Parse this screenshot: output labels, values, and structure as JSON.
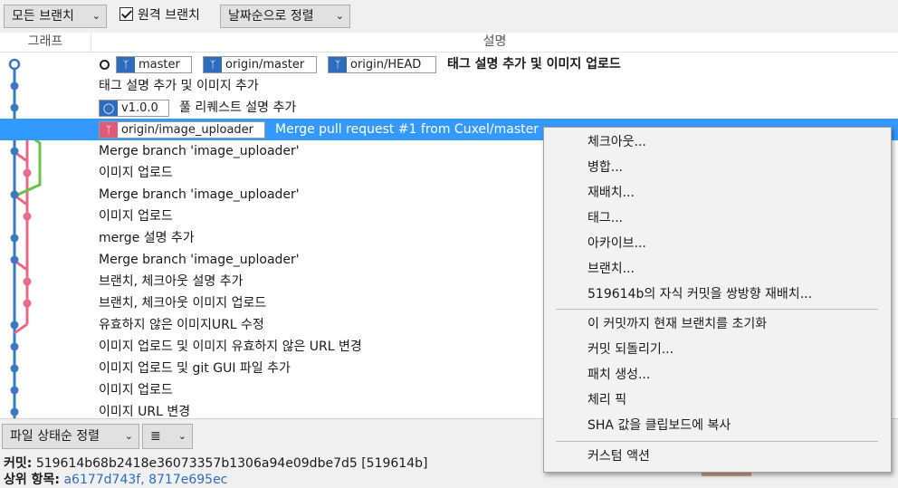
{
  "toolbar": {
    "branch_filter": "모든 브랜치",
    "remote_branch_label": "원격 브랜치",
    "remote_branch_checked": true,
    "sort_order": "날짜순으로 정렬"
  },
  "columns": {
    "graph": "그래프",
    "description": "설명"
  },
  "commits": [
    {
      "message": "태그 설명 추가 및 이미지 업로드",
      "refs": [
        {
          "name": "master",
          "type": "branch"
        },
        {
          "name": "origin/master",
          "type": "remote"
        },
        {
          "name": "origin/HEAD",
          "type": "remote"
        }
      ],
      "head": true
    },
    {
      "message": "태그 설명 추가 및 이미지 추가"
    },
    {
      "message": "풀 리퀘스트 설명 추가",
      "refs": [
        {
          "name": "v1.0.0",
          "type": "tag"
        }
      ]
    },
    {
      "message": "Merge pull request #1 from Cuxel/master",
      "refs": [
        {
          "name": "origin/image_uploader",
          "type": "remote"
        }
      ],
      "selected": true
    },
    {
      "message": "Merge branch 'image_uploader'"
    },
    {
      "message": "이미지 업로드"
    },
    {
      "message": "Merge branch 'image_uploader'"
    },
    {
      "message": "이미지 업로드"
    },
    {
      "message": "merge 설명 추가"
    },
    {
      "message": "Merge branch 'image_uploader'"
    },
    {
      "message": "브랜치, 체크아웃 설명 추가"
    },
    {
      "message": "브랜치, 체크아웃 이미지 업로드"
    },
    {
      "message": "유효하지 않은 이미지URL 수정"
    },
    {
      "message": "이미지 업로드 및 이미지 유효하지 않은 URL 변경"
    },
    {
      "message": "이미지 업로드 및 git GUI 파일 추가"
    },
    {
      "message": "이미지 업로드"
    },
    {
      "message": "이미지 URL 변경"
    }
  ],
  "bottom": {
    "file_sort": "파일 상태순 정렬",
    "view_mode_icon": "≣",
    "commit_label": "커밋:",
    "commit_value": "519614b68b2418e36073357b1306a94e09dbe7d5 [519614b]",
    "parent_label": "상위 항목:",
    "parent_value": "a6177d743f, 8717e695ec"
  },
  "context_menu": {
    "groups": [
      [
        "체크아웃...",
        "병합...",
        "재배치...",
        "태그...",
        "아카이브...",
        "브랜치...",
        "519614b의 자식 커밋을 쌍방향 재배치..."
      ],
      [
        "이 커밋까지 현재 브랜치를 초기화",
        "커밋 되돌리기...",
        "패치 생성...",
        "체리 픽",
        "SHA 값을 클립보드에 복사"
      ],
      [
        "커스텀 액션"
      ]
    ]
  },
  "colors": {
    "selection": "#3399ff",
    "main_lane": "#3b78c4",
    "pink_lane": "#e86a8a",
    "green_lane": "#6cc24a",
    "ref_blue": "#2e6dbd",
    "ref_red": "#e05a79"
  }
}
